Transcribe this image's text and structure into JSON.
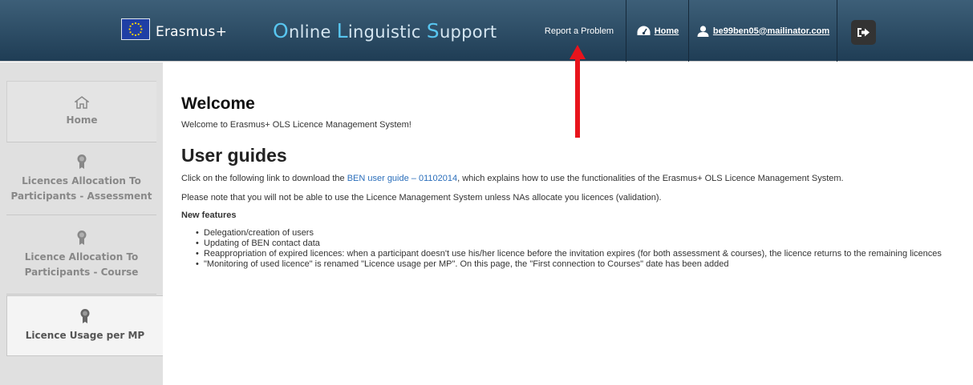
{
  "header": {
    "brand": "Erasmus+",
    "title_parts": [
      {
        "cap": "O",
        "rest": "nline "
      },
      {
        "cap": "L",
        "rest": "inguistic "
      },
      {
        "cap": "S",
        "rest": "upport"
      }
    ],
    "report_link": "Report a Problem",
    "home_link": "Home",
    "user_email": "be99ben05@mailinator.com",
    "icons": {
      "flag": "eu-flag-icon",
      "home": "dashboard-icon",
      "user": "user-icon",
      "logout": "logout-icon"
    }
  },
  "sidebar": {
    "items": [
      {
        "label": "Home",
        "icon": "home-icon"
      },
      {
        "label": "Licences Allocation To Participants - Assessment",
        "line1": "Licences Allocation To",
        "line2": "Participants - Assessment",
        "icon": "ribbon-icon"
      },
      {
        "label": "Licence Allocation To Participants - Course",
        "line1": "Licence Allocation To",
        "line2": "Participants - Course",
        "icon": "ribbon-icon"
      },
      {
        "label": "Licence Usage per MP",
        "icon": "ribbon-icon",
        "active": true
      }
    ]
  },
  "main": {
    "welcome_title": "Welcome",
    "welcome_text": "Welcome to Erasmus+ OLS Licence Management System!",
    "guides_title": "User guides",
    "guide_pre": "Click on the following link to download the ",
    "guide_link": "BEN user guide – 01102014",
    "guide_post": ", which explains how to use the functionalities of the Erasmus+ OLS Licence Management System.",
    "note": "Please note that you will not be able to use the Licence Management System unless NAs allocate you licences (validation).",
    "features_title": "New features",
    "features": [
      "Delegation/creation of users",
      "Updating of BEN contact data",
      "Reappropriation of expired licences: when a participant doesn't use his/her licence before the invitation expires (for both assessment & courses), the licence returns to the remaining licences",
      "\"Monitoring of used licence\" is renamed \"Licence usage per MP\". On this page, the \"First connection to Courses\" date has been added"
    ]
  },
  "colors": {
    "header_top": "#3d5f78",
    "header_bottom": "#1f3d55",
    "title_accent": "#58c6f0",
    "link": "#2a6ebb",
    "annotation_arrow": "#e8141c"
  }
}
